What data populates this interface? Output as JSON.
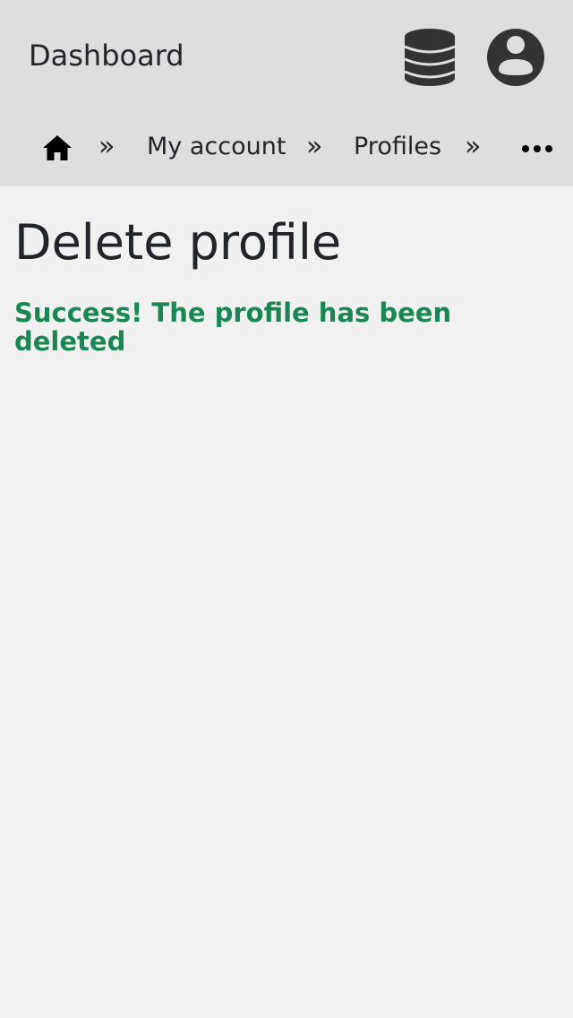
{
  "header": {
    "title": "Dashboard",
    "icons": {
      "database": "database-icon",
      "account": "user-circle-icon"
    }
  },
  "breadcrumb": {
    "home_icon": "home-icon",
    "separator": "»",
    "items": [
      {
        "label": "My account"
      },
      {
        "label": "Profiles"
      }
    ],
    "overflow_icon": "ellipsis-icon"
  },
  "main": {
    "title": "Delete profile",
    "alert": "Success! The profile has been deleted"
  },
  "colors": {
    "header_bg": "#dedede",
    "page_bg": "#f1f1f1",
    "text": "#212529",
    "icon": "#333333",
    "success": "#198754"
  }
}
